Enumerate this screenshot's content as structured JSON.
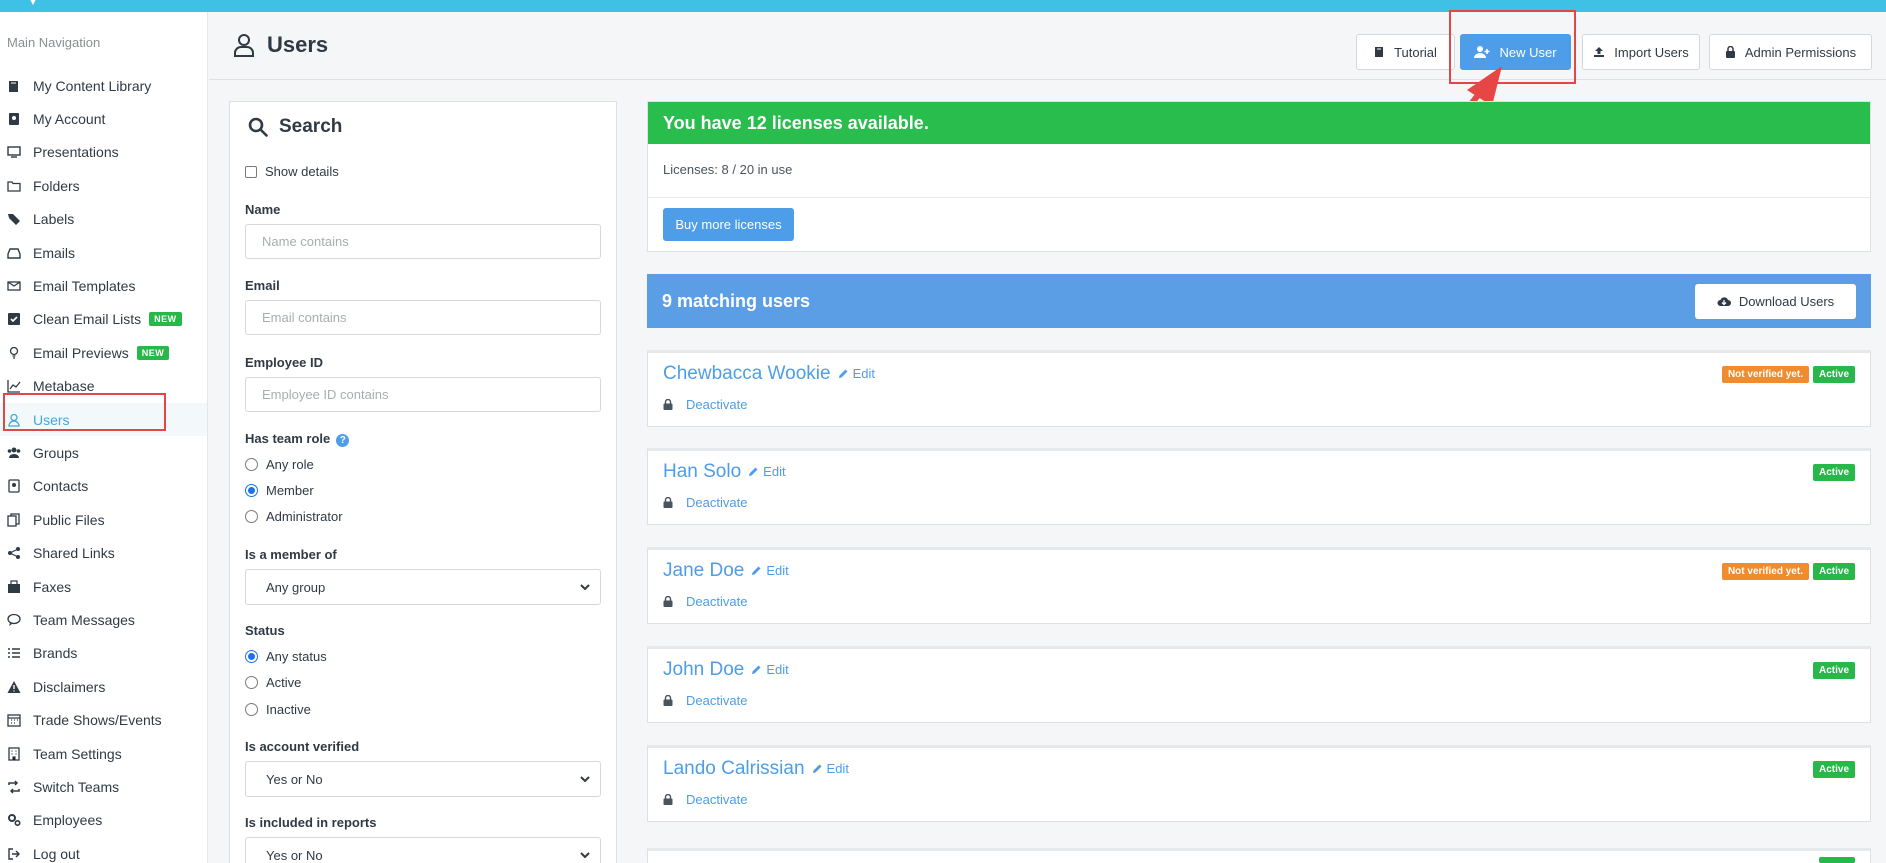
{
  "nav": {
    "heading": "Main Navigation",
    "items": [
      {
        "label": "My Content Library",
        "icon": "book-icon"
      },
      {
        "label": "My Account",
        "icon": "id-badge-icon"
      },
      {
        "label": "Presentations",
        "icon": "monitor-icon"
      },
      {
        "label": "Folders",
        "icon": "folder-icon"
      },
      {
        "label": "Labels",
        "icon": "tags-icon"
      },
      {
        "label": "Emails",
        "icon": "inbox-icon"
      },
      {
        "label": "Email Templates",
        "icon": "envelope-icon"
      },
      {
        "label": "Clean Email Lists",
        "icon": "check-square-icon",
        "badge": "NEW"
      },
      {
        "label": "Email Previews",
        "icon": "lightbulb-icon",
        "badge": "NEW"
      },
      {
        "label": "Metabase",
        "icon": "line-chart-icon"
      },
      {
        "label": "Users",
        "icon": "user-icon",
        "active": true
      },
      {
        "label": "Groups",
        "icon": "users-icon"
      },
      {
        "label": "Contacts",
        "icon": "address-book-icon"
      },
      {
        "label": "Public Files",
        "icon": "files-icon"
      },
      {
        "label": "Shared Links",
        "icon": "share-icon"
      },
      {
        "label": "Faxes",
        "icon": "fax-icon"
      },
      {
        "label": "Team Messages",
        "icon": "comment-icon"
      },
      {
        "label": "Brands",
        "icon": "list-icon"
      },
      {
        "label": "Disclaimers",
        "icon": "warning-icon"
      },
      {
        "label": "Trade Shows/Events",
        "icon": "calendar-icon"
      },
      {
        "label": "Team Settings",
        "icon": "building-icon"
      },
      {
        "label": "Switch Teams",
        "icon": "retweet-icon"
      },
      {
        "label": "Employees",
        "icon": "cogs-icon"
      },
      {
        "label": "Log out",
        "icon": "sign-out-icon"
      }
    ]
  },
  "header": {
    "title": "Users",
    "buttons": {
      "tutorial": "Tutorial",
      "new_user": "New User",
      "import_users": "Import Users",
      "admin_permissions": "Admin Permissions"
    }
  },
  "search": {
    "title": "Search",
    "show_details": "Show details",
    "name_label": "Name",
    "name_placeholder": "Name contains",
    "email_label": "Email",
    "email_placeholder": "Email contains",
    "employee_id_label": "Employee ID",
    "employee_id_placeholder": "Employee ID contains",
    "team_role_label": "Has team role",
    "team_roles": [
      "Any role",
      "Member",
      "Administrator"
    ],
    "team_role_selected": "Member",
    "member_of_label": "Is a member of",
    "member_of_value": "Any group",
    "status_label": "Status",
    "statuses": [
      "Any status",
      "Active",
      "Inactive"
    ],
    "status_selected": "Any status",
    "verified_label": "Is account verified",
    "verified_value": "Yes or No",
    "reports_label": "Is included in reports",
    "reports_value": "Yes or No"
  },
  "licenses": {
    "banner": "You have 12 licenses available.",
    "usage": "Licenses: 8 / 20 in use",
    "buy_button": "Buy more licenses"
  },
  "matching": {
    "title": "9 matching users",
    "download_button": "Download Users"
  },
  "users": [
    {
      "name": "Chewbacca Wookie",
      "edit": "Edit",
      "deactivate": "Deactivate",
      "badges": [
        "Not verified yet.",
        "Active"
      ]
    },
    {
      "name": "Han Solo",
      "edit": "Edit",
      "deactivate": "Deactivate",
      "badges": [
        "Active"
      ]
    },
    {
      "name": "Jane Doe",
      "edit": "Edit",
      "deactivate": "Deactivate",
      "badges": [
        "Not verified yet.",
        "Active"
      ]
    },
    {
      "name": "John Doe",
      "edit": "Edit",
      "deactivate": "Deactivate",
      "badges": [
        "Active"
      ]
    },
    {
      "name": "Lando Calrissian",
      "edit": "Edit",
      "deactivate": "Deactivate",
      "badges": [
        "Active"
      ]
    }
  ],
  "colors": {
    "topbar": "#3fc1e6",
    "primary": "#4d9de8",
    "success": "#28bd4c",
    "warning": "#f08c2e",
    "highlight": "#e04848"
  }
}
